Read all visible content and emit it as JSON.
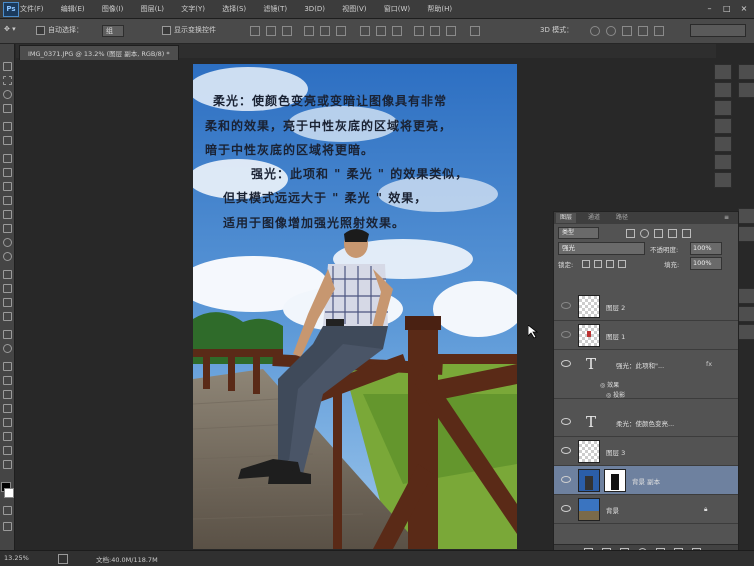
{
  "menubar": {
    "logo": "Ps",
    "items": [
      "文件(F)",
      "编辑(E)",
      "图像(I)",
      "图层(L)",
      "文字(Y)",
      "选择(S)",
      "滤镜(T)",
      "3D(D)",
      "视图(V)",
      "窗口(W)",
      "帮助(H)"
    ],
    "window_buttons": [
      "–",
      "□",
      "×"
    ]
  },
  "options": {
    "auto_select": "自动选择：",
    "auto_select_target": "组",
    "show_transform": "显示变换控件",
    "mode_3d": "3D 模式："
  },
  "document": {
    "tab_title": "IMG_0371.JPG @ 13.2% (图层 副本, RGB/8) *"
  },
  "canvas_text": [
    "柔光：使颜色变亮或变暗让图像具有非常",
    "柔和的效果，亮于中性灰底的区域将更亮，",
    "暗于中性灰底的区域将更暗。",
    "强光：此项和 \" 柔光 \" 的效果类似，",
    "但其模式远远大于 \" 柔光 \" 效果，",
    "适用于图像增加强光照射效果。"
  ],
  "status": {
    "zoom": "13.25%",
    "doc_info": "文档:40.0M/118.7M"
  },
  "layers_panel": {
    "tabs": [
      "图层",
      "通道",
      "路径"
    ],
    "kind_filter": "类型",
    "blend_mode": "强光",
    "opacity_label": "不透明度:",
    "opacity_value": "100%",
    "lock_label": "锁定:",
    "fill_label": "填充:",
    "fill_value": "100%",
    "layers": [
      {
        "name": "图层 2",
        "type": "pixel"
      },
      {
        "name": "图层 1",
        "type": "pixel"
      },
      {
        "name": "强光：此项和\"...",
        "type": "text",
        "fx": "fx"
      },
      {
        "name": "效果",
        "type": "effect"
      },
      {
        "name": "投影",
        "type": "effect"
      },
      {
        "name": "柔光：使颜色变亮...",
        "type": "text"
      },
      {
        "name": "图层 3",
        "type": "pixel"
      },
      {
        "name": "背景 副本",
        "type": "photo",
        "selected": true
      },
      {
        "name": "背景",
        "type": "photo",
        "locked": true
      }
    ]
  },
  "colors": {
    "accent_selected": "#6e819f",
    "panel": "#535353",
    "workspace": "#282828"
  }
}
